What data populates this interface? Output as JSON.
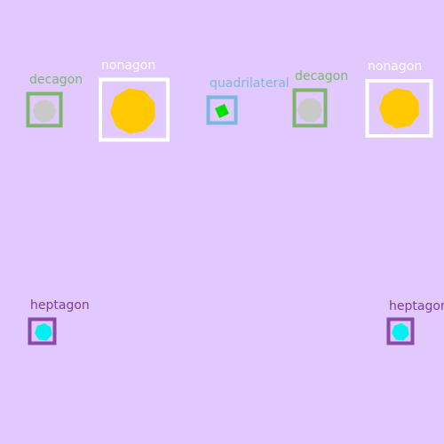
{
  "background": "#e2c9fd",
  "shapes": [
    {
      "label": "decagon",
      "shape": "decagon",
      "fill": "#c9c9c9",
      "box_color": "#7fb46e",
      "label_color": "#7fb46e"
    },
    {
      "label": "nonagon",
      "shape": "nonagon",
      "fill": "#ffc800",
      "box_color": "#ffffff",
      "label_color": "#ffffff"
    },
    {
      "label": "quadrilateral",
      "shape": "quadrilateral",
      "fill": "#00e000",
      "box_color": "#7eb6e2",
      "label_color": "#7eb6e2"
    },
    {
      "label": "decagon",
      "shape": "decagon",
      "fill": "#c9c9c9",
      "box_color": "#7fb46e",
      "label_color": "#7fb46e"
    },
    {
      "label": "nonagon",
      "shape": "nonagon",
      "fill": "#ffc800",
      "box_color": "#ffffff",
      "label_color": "#ffffff"
    },
    {
      "label": "heptagon",
      "shape": "heptagon",
      "fill": "#00f0f0",
      "box_color": "#8a4aa8",
      "label_color": "#7a3d9a"
    },
    {
      "label": "heptagon",
      "shape": "heptagon",
      "fill": "#00f0f0",
      "box_color": "#8a4aa8",
      "label_color": "#7a3d9a"
    }
  ]
}
